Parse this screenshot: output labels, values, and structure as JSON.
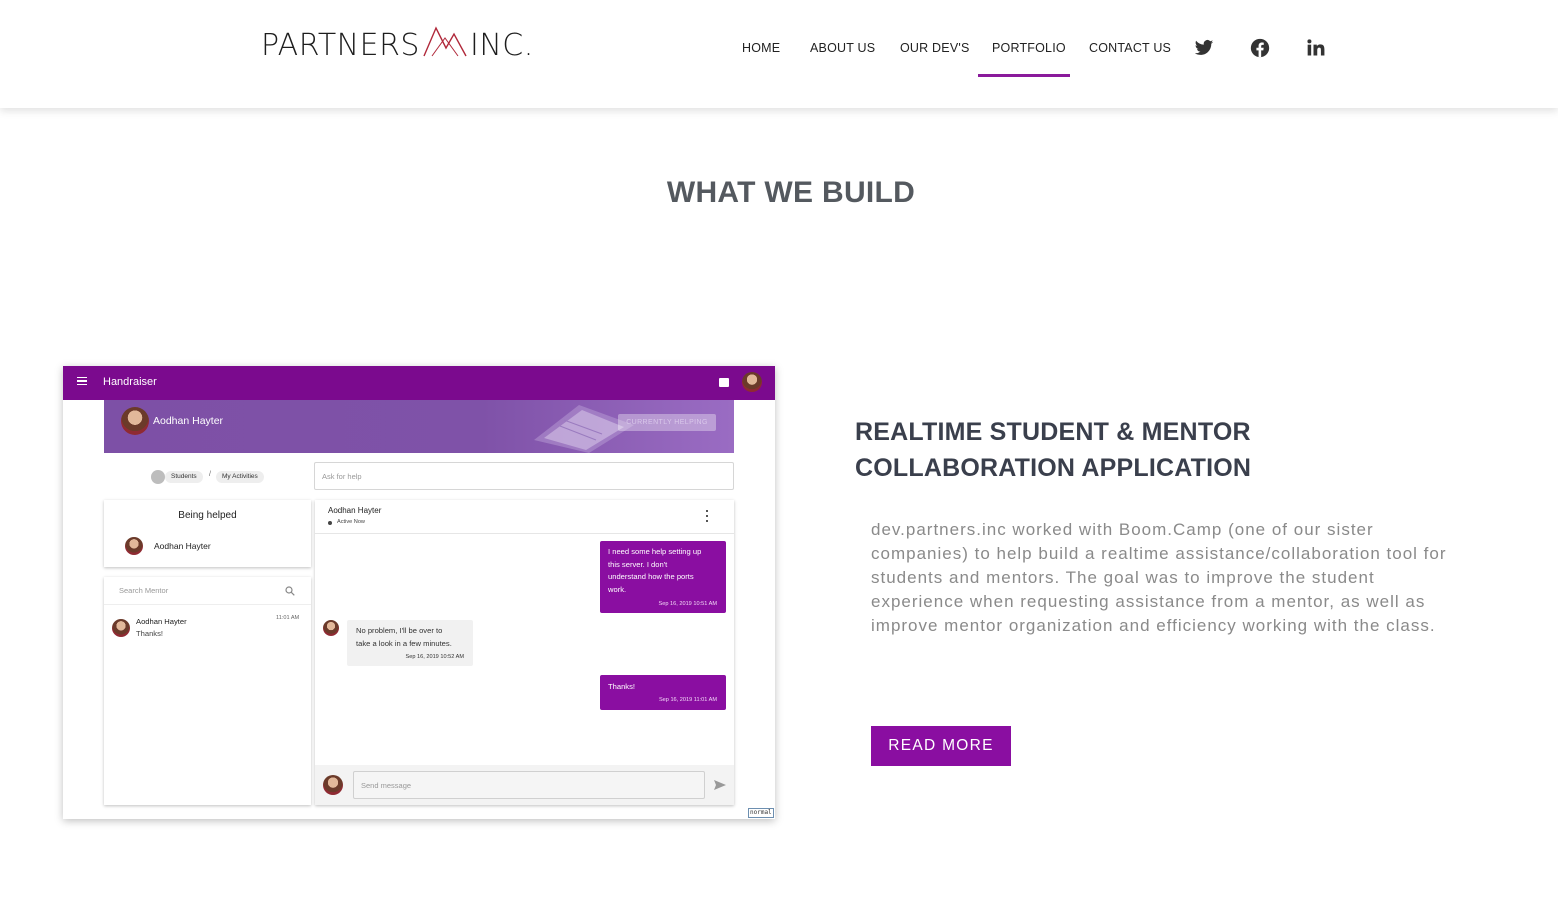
{
  "header": {
    "logo_left": "PARTNERS",
    "logo_right": "INC.",
    "nav": {
      "home": "HOME",
      "about": "ABOUT US",
      "devs": "OUR DEV'S",
      "portfolio": "PORTFOLIO",
      "contact": "CONTACT US"
    },
    "active_item": "PORTFOLIO",
    "social_icons": [
      "twitter-icon",
      "facebook-icon",
      "linkedin-icon"
    ]
  },
  "section": {
    "title": "WHAT WE BUILD"
  },
  "project": {
    "title": "REALTIME STUDENT & MENTOR COLLABORATION APPLICATION",
    "description": "dev.partners.inc worked with Boom.Camp (one of our sister companies) to help build a realtime assistance/collaboration tool for students and mentors. The goal was to improve the student experience when requesting assistance from a mentor, as well as improve mentor organization and efficiency working with the class.",
    "button": "READ MORE"
  },
  "screenshot": {
    "app_title": "Handraiser",
    "banner_name": "Aodhan Hayter",
    "banner_badge": "CURRENTLY HELPING",
    "breadcrumb_students": "Students",
    "breadcrumb_sep": "/",
    "breadcrumb_activities": "My Activities",
    "ask_placeholder": "Ask for help",
    "being_helped_title": "Being helped",
    "being_helped_name": "Aodhan Hayter",
    "search_placeholder": "Search Mentor",
    "list_name": "Aodhan Hayter",
    "list_msg": "Thanks!",
    "list_time": "11:01 AM",
    "chat_name": "Aodhan Hayter",
    "chat_status": "Active Now",
    "messages": [
      {
        "line1": "I need some help setting up",
        "line2": "this server. I don't",
        "line3": "understand how the ports",
        "line4": "work.",
        "time": "Sep 16, 2019 10:51 AM"
      },
      {
        "line1": "No problem, I'll be over to",
        "line2": "take a look in a few minutes.",
        "time": "Sep 16, 2019 10:52 AM"
      },
      {
        "line1": "Thanks!",
        "time": "Sep 16, 2019 11:01 AM"
      }
    ],
    "send_placeholder": "Send message",
    "corner_tag": "normal",
    "colors": {
      "primary": "#7b0a8e",
      "accent": "#8a0ea1"
    }
  }
}
